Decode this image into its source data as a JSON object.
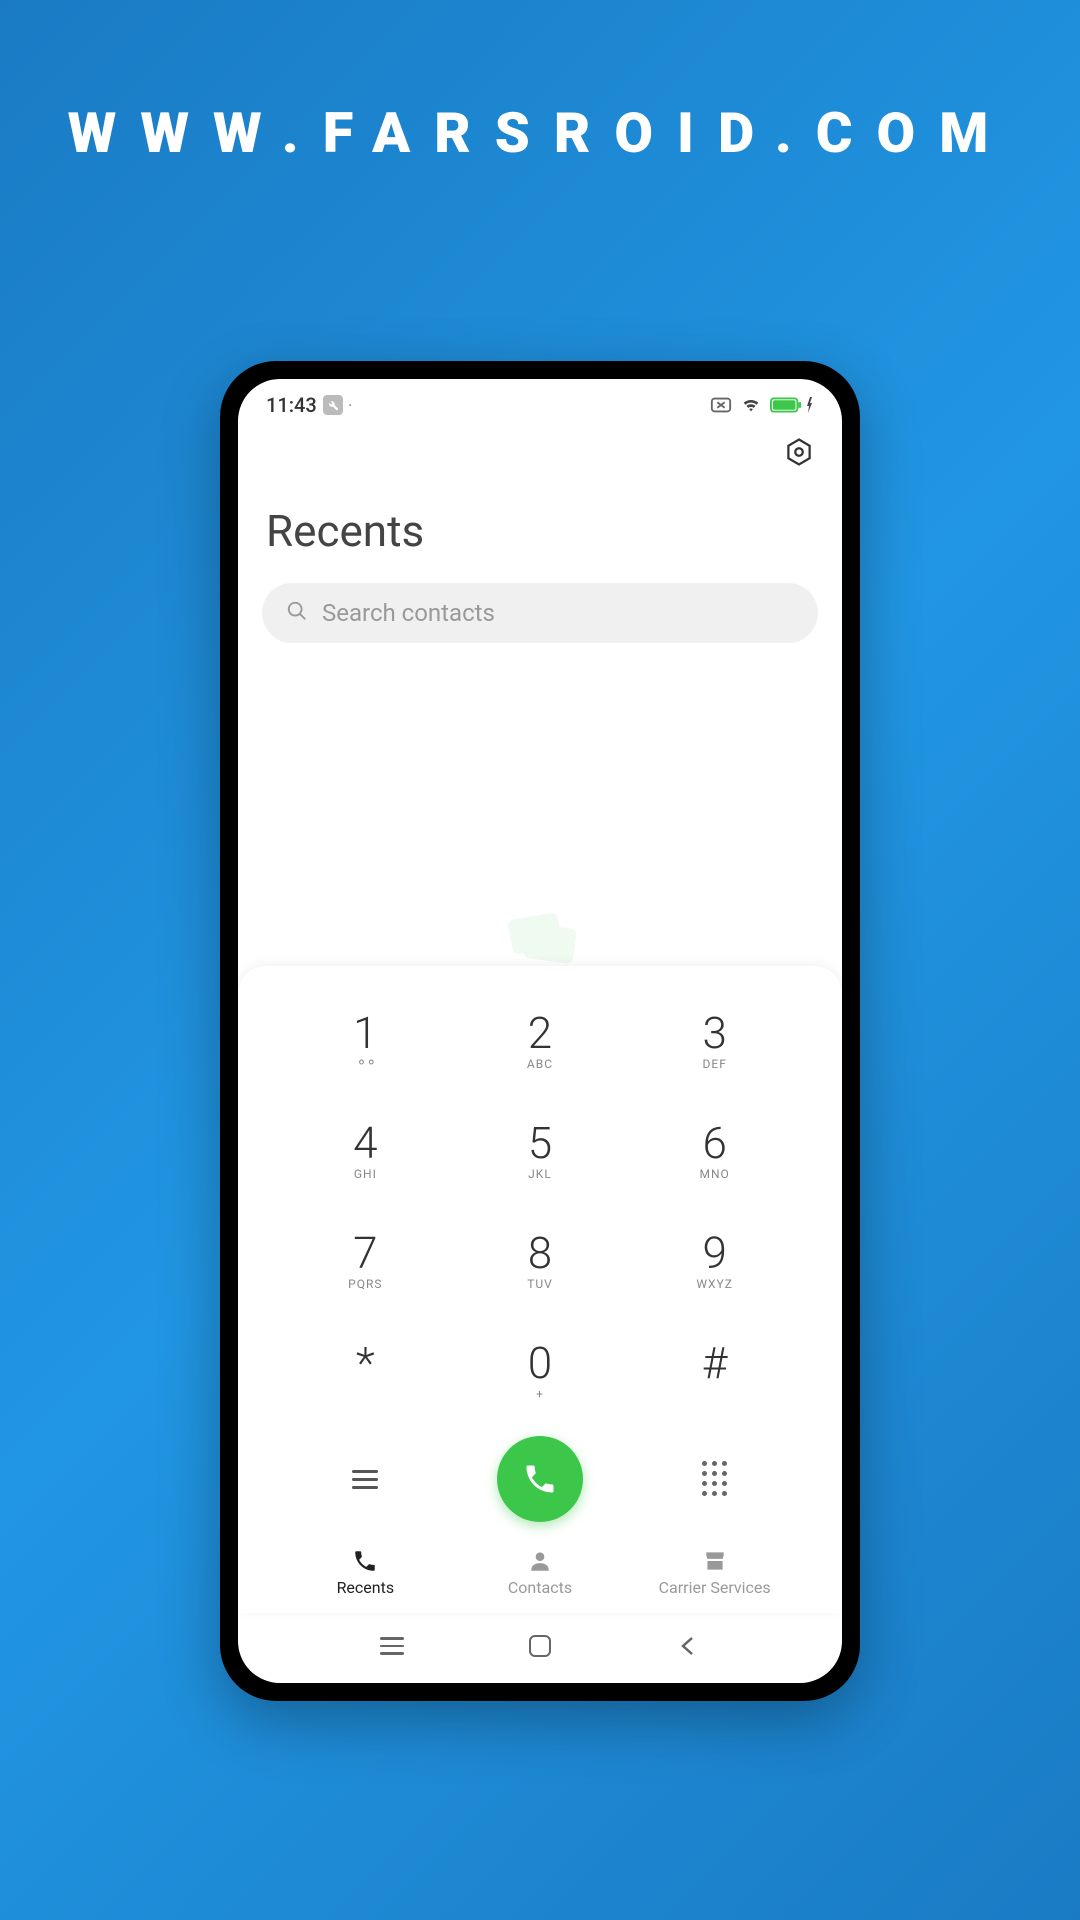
{
  "watermark": "WWW.FARSROID.COM",
  "status": {
    "time": "11:43"
  },
  "header": {
    "title": "Recents"
  },
  "search": {
    "placeholder": "Search contacts"
  },
  "dialpad": {
    "keys": [
      {
        "digit": "1",
        "letters": ""
      },
      {
        "digit": "2",
        "letters": "ABC"
      },
      {
        "digit": "3",
        "letters": "DEF"
      },
      {
        "digit": "4",
        "letters": "GHI"
      },
      {
        "digit": "5",
        "letters": "JKL"
      },
      {
        "digit": "6",
        "letters": "MNO"
      },
      {
        "digit": "7",
        "letters": "PQRS"
      },
      {
        "digit": "8",
        "letters": "TUV"
      },
      {
        "digit": "9",
        "letters": "WXYZ"
      },
      {
        "digit": "*",
        "letters": ""
      },
      {
        "digit": "0",
        "letters": "+"
      },
      {
        "digit": "#",
        "letters": ""
      }
    ]
  },
  "tabs": {
    "recents": "Recents",
    "contacts": "Contacts",
    "carrier": "Carrier Services"
  },
  "colors": {
    "accent_green": "#3cc64a",
    "bg_gradient_start": "#1a7bc4",
    "bg_gradient_end": "#2196e3"
  }
}
